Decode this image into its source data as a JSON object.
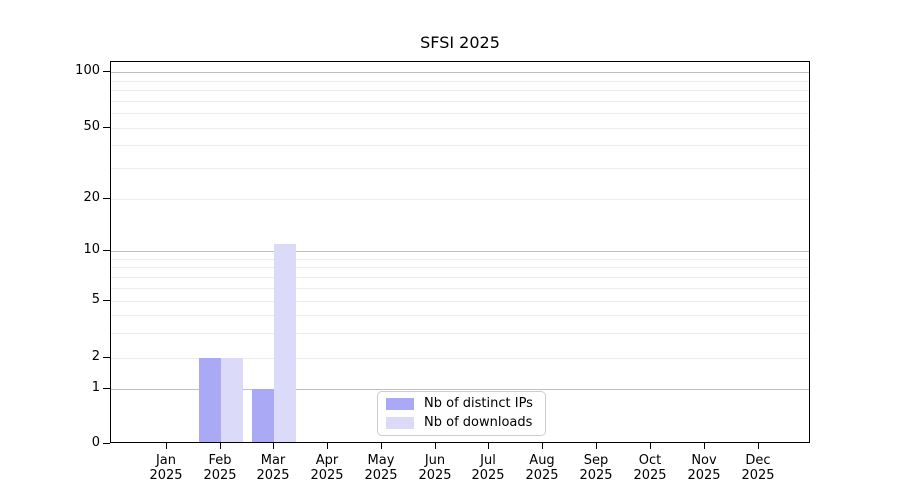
{
  "chart_data": {
    "type": "bar",
    "title": "SFSI 2025",
    "categories": [
      "Jan 2025",
      "Feb 2025",
      "Mar 2025",
      "Apr 2025",
      "May 2025",
      "Jun 2025",
      "Jul 2025",
      "Aug 2025",
      "Sep 2025",
      "Oct 2025",
      "Nov 2025",
      "Dec 2025"
    ],
    "xtick_labels": [
      {
        "line1": "Jan",
        "line2": "2025"
      },
      {
        "line1": "Feb",
        "line2": "2025"
      },
      {
        "line1": "Mar",
        "line2": "2025"
      },
      {
        "line1": "Apr",
        "line2": "2025"
      },
      {
        "line1": "May",
        "line2": "2025"
      },
      {
        "line1": "Jun",
        "line2": "2025"
      },
      {
        "line1": "Jul",
        "line2": "2025"
      },
      {
        "line1": "Aug",
        "line2": "2025"
      },
      {
        "line1": "Sep",
        "line2": "2025"
      },
      {
        "line1": "Oct",
        "line2": "2025"
      },
      {
        "line1": "Nov",
        "line2": "2025"
      },
      {
        "line1": "Dec",
        "line2": "2025"
      }
    ],
    "series": [
      {
        "name": "Nb of distinct IPs",
        "color": "#a9a9f6",
        "values": [
          0,
          2,
          1,
          0,
          0,
          0,
          0,
          0,
          0,
          0,
          0,
          0
        ]
      },
      {
        "name": "Nb of downloads",
        "color": "#dbdbf9",
        "values": [
          0,
          2,
          11,
          0,
          0,
          0,
          0,
          0,
          0,
          0,
          0,
          0
        ]
      }
    ],
    "ytick_labels": [
      "0",
      "1",
      "2",
      "5",
      "10",
      "20",
      "50",
      "100"
    ],
    "ytick_values": [
      0,
      1,
      2,
      5,
      10,
      20,
      50,
      100
    ],
    "yscale": "log-like with zero baseline",
    "ylim": [
      0,
      115
    ],
    "grid": "horizontal",
    "legend_position": "lower center",
    "axis_color": "#000000",
    "major_grid_color": "#bfbfbf",
    "minor_grid_color": "#ececec"
  }
}
